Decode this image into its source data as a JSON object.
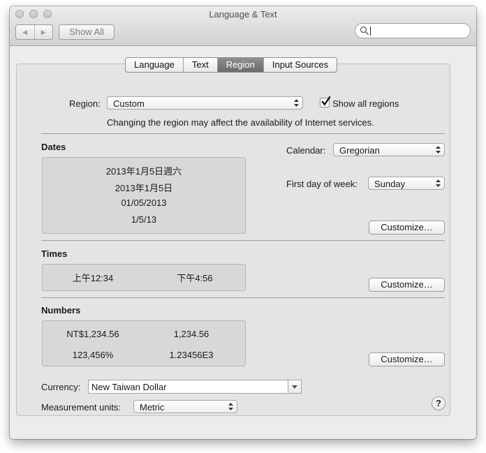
{
  "window": {
    "title": "Language & Text"
  },
  "toolbar": {
    "back_icon": "chevron-left-icon",
    "forward_icon": "chevron-right-icon",
    "show_all_label": "Show All",
    "search_value": ""
  },
  "tabs": [
    {
      "label": "Language",
      "selected": false
    },
    {
      "label": "Text",
      "selected": false
    },
    {
      "label": "Region",
      "selected": true
    },
    {
      "label": "Input Sources",
      "selected": false
    }
  ],
  "region": {
    "label": "Region:",
    "value": "Custom",
    "show_all_label": "Show all regions",
    "show_all_checked": true,
    "notice": "Changing the region may affect the availability of Internet services."
  },
  "dates": {
    "heading": "Dates",
    "samples": [
      "2013年1月5日週六",
      "2013年1月5日",
      "01/05/2013",
      "1/5/13"
    ],
    "calendar_label": "Calendar:",
    "calendar_value": "Gregorian",
    "first_day_label": "First day of week:",
    "first_day_value": "Sunday",
    "customize_label": "Customize…"
  },
  "times": {
    "heading": "Times",
    "samples": [
      "上午12:34",
      "下午4:56"
    ],
    "customize_label": "Customize…"
  },
  "numbers": {
    "heading": "Numbers",
    "samples": [
      "NT$1,234.56",
      "1,234.56",
      "123,456%",
      "1.23456E3"
    ],
    "customize_label": "Customize…"
  },
  "currency": {
    "label": "Currency:",
    "value": "New Taiwan Dollar"
  },
  "measurement": {
    "label": "Measurement units:",
    "value": "Metric"
  },
  "help_label": "?"
}
